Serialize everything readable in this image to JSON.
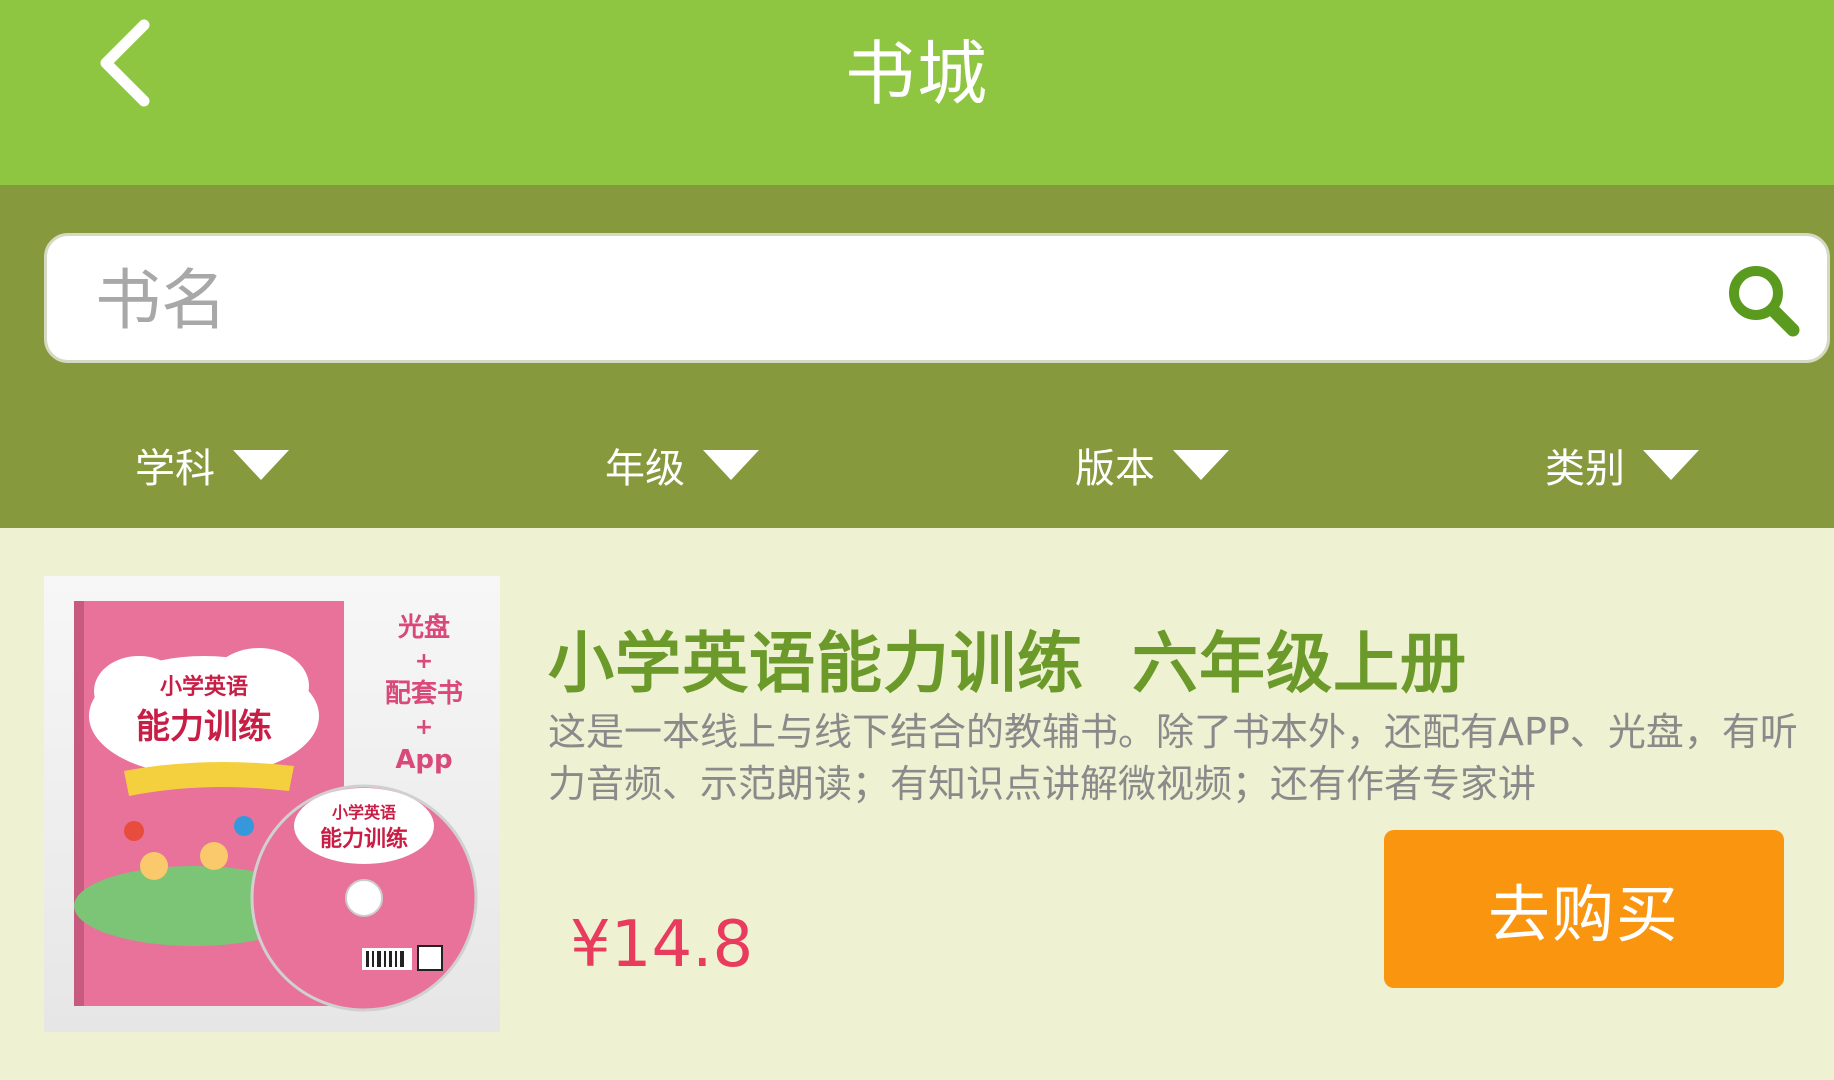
{
  "header": {
    "title": "书城",
    "back_icon": "chevron-left-icon"
  },
  "search": {
    "placeholder": "书名",
    "value": "",
    "icon": "search-icon"
  },
  "filters": [
    {
      "label": "学科"
    },
    {
      "label": "年级"
    },
    {
      "label": "版本"
    },
    {
      "label": "类别"
    }
  ],
  "book": {
    "title": "小学英语能力训练  六年级上册",
    "description": "这是一本线上与线下结合的教辅书。除了书本外，还配有APP、光盘，有听力音频、示范朗读；有知识点讲解微视频；还有作者专家讲",
    "price": "¥14.8",
    "buy_label": "去购买",
    "cover": {
      "title_line1": "小学英语",
      "title_line2": "能力训练",
      "side_text": [
        "光盘",
        "+",
        "配套书",
        "+",
        "App"
      ],
      "disc_line1": "小学英语",
      "disc_line2": "能力训练"
    }
  },
  "colors": {
    "header_green": "#8fc641",
    "filter_olive": "#86993d",
    "background": "#eef2d2",
    "title_green": "#6b9a2a",
    "price_red": "#e83b5d",
    "buy_orange": "#f9950f",
    "search_icon_green": "#5a9a1f"
  }
}
